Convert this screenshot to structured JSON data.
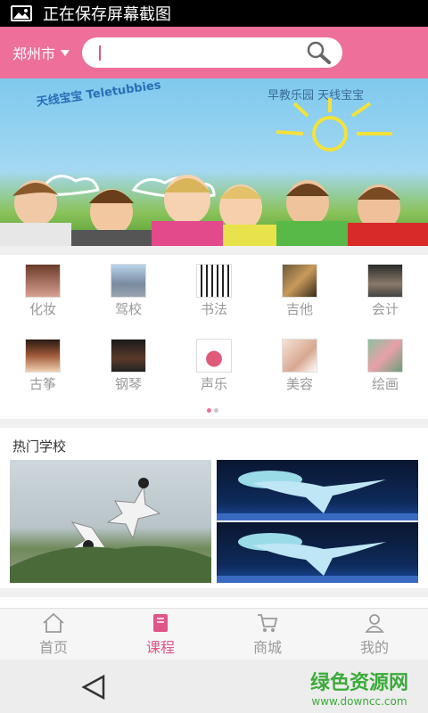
{
  "status_bar": {
    "text": "正在保存屏幕截图",
    "icon": "image-icon"
  },
  "header": {
    "city": "郑州市",
    "search": {
      "value": "",
      "placeholder": ""
    },
    "accent": "#ed6f9a"
  },
  "banner": {
    "logo": "天线宝宝 Teletubbies",
    "slogan": "早教乐园 天线宝宝"
  },
  "categories": [
    {
      "label": "化妆",
      "icon": "makeup-photo"
    },
    {
      "label": "驾校",
      "icon": "driving-school-photo"
    },
    {
      "label": "书法",
      "icon": "calligraphy-photo"
    },
    {
      "label": "吉他",
      "icon": "guitar-photo"
    },
    {
      "label": "会计",
      "icon": "accounting-photo"
    },
    {
      "label": "古筝",
      "icon": "guzheng-photo"
    },
    {
      "label": "钢琴",
      "icon": "piano-photo"
    },
    {
      "label": "声乐",
      "icon": "vocal-photo"
    },
    {
      "label": "美容",
      "icon": "beauty-photo"
    },
    {
      "label": "绘画",
      "icon": "painting-photo"
    }
  ],
  "pager": {
    "pages": 2,
    "current": 1
  },
  "hot_schools": {
    "title": "热门学校"
  },
  "tabs": [
    {
      "label": "首页",
      "icon": "home-icon",
      "active": false
    },
    {
      "label": "课程",
      "icon": "book-icon",
      "active": true
    },
    {
      "label": "商城",
      "icon": "cart-icon",
      "active": false
    },
    {
      "label": "我的",
      "icon": "user-icon",
      "active": false
    }
  ],
  "watermark": {
    "name": "绿色资源网",
    "url": "www.downcc.com"
  }
}
